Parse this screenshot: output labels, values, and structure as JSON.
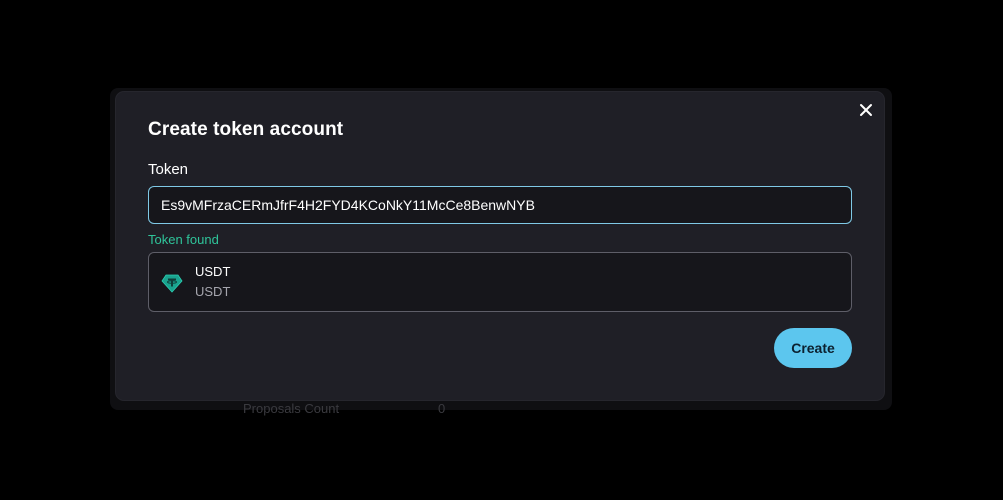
{
  "modal": {
    "title": "Create token account",
    "token_label": "Token",
    "token_value": "Es9vMFrzaCERmJfrF4H2FYD4KCoNkY11McCe8BenwNYB",
    "status_text": "Token found",
    "token_result": {
      "name": "USDT",
      "symbol": "USDT",
      "logo_icon": "tether-diamond-icon"
    },
    "close_icon": "close-icon",
    "create_label": "Create"
  },
  "background": {
    "fragment_proposals_label": "Proposals Count",
    "fragment_proposals_value": "0"
  },
  "colors": {
    "accent": "#5cc6ee",
    "input_border": "#7fc9e6",
    "success": "#2fc49a",
    "modal_bg": "#1f1f26",
    "page_bg": "#000000"
  }
}
